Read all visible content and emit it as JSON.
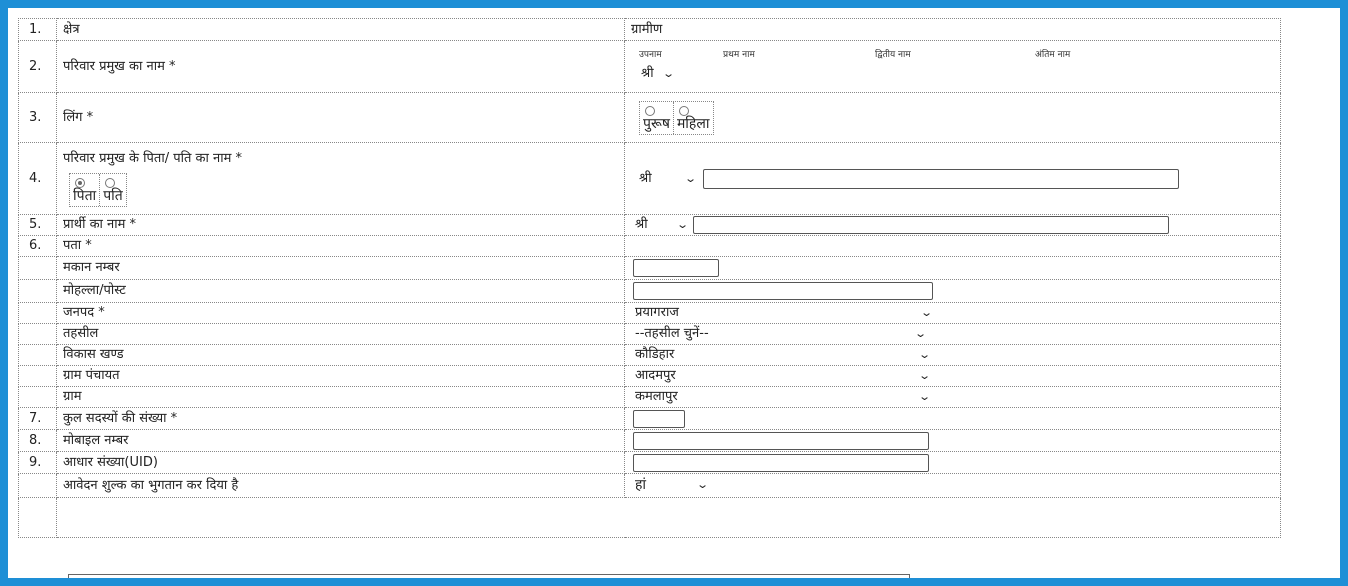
{
  "prefix_options": {
    "selected": "श्री"
  },
  "fee_options": {
    "selected": "हां"
  },
  "rows": {
    "r1": {
      "num": "1.",
      "label": "क्षेत्र",
      "value": "ग्रामीण"
    },
    "r2": {
      "num": "2.",
      "label": "परिवार प्रमुख का नाम *",
      "heads": [
        "उपनाम",
        "प्रथम नाम",
        "द्वितीय नाम",
        "अंतिम नाम"
      ]
    },
    "r3": {
      "num": "3.",
      "label": "लिंग *",
      "options": [
        "पुरूष",
        "महिला"
      ]
    },
    "r4": {
      "num": "4.",
      "label": "परिवार प्रमुख के पिता/ पति का नाम *",
      "options": [
        "पिता",
        "पति"
      ],
      "selected": "पिता"
    },
    "r5": {
      "num": "5.",
      "label": "प्रार्थी का नाम *"
    },
    "r6": {
      "num": "6.",
      "label": "पता *"
    },
    "house": {
      "label": "मकान नम्बर",
      "value": ""
    },
    "mohalla": {
      "label": "मोहल्ला/पोस्ट",
      "value": ""
    },
    "district": {
      "label": "जनपद *",
      "value": "प्रयागराज"
    },
    "tehsil": {
      "label": "तहसील",
      "value": "--तहसील चुनें--"
    },
    "block": {
      "label": "विकास खण्ड",
      "value": "कौडिहार"
    },
    "panchayat": {
      "label": "ग्राम पंचायत",
      "value": "आदमपुर"
    },
    "village": {
      "label": "ग्राम",
      "value": "कमलापुर"
    },
    "r7": {
      "num": "7.",
      "label": "कुल सदस्यों की संख्या *",
      "value": ""
    },
    "r8": {
      "num": "8.",
      "label": "मोबाइल नम्बर",
      "value": ""
    },
    "r9": {
      "num": "9.",
      "label": "आधार संख्या(UID)",
      "value": ""
    },
    "fee": {
      "label": "आवेदन शुल्क का भुगतान कर दिया है"
    }
  }
}
